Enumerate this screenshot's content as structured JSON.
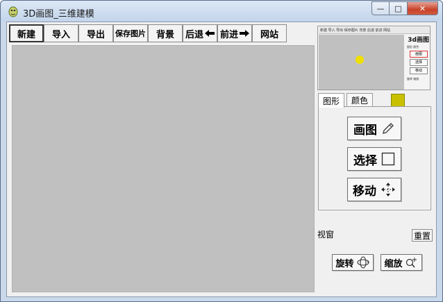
{
  "window": {
    "title": "3D画图_三维建模",
    "caption": {
      "minimize": "—",
      "maximize": "□",
      "close": "✕"
    }
  },
  "toolbar": {
    "new_label": "新建",
    "import_label": "导入",
    "export_label": "导出",
    "save_image_label": "保存图片",
    "background_label": "背景",
    "back_label": "后退",
    "forward_label": "前进",
    "website_label": "网站"
  },
  "preview": {
    "logo": "3d画图",
    "toolbar_text": "新建 导入 导出 保存图片 背景 后退 前进 网站",
    "tabs_text": "图形 颜色",
    "draw": "画图",
    "select": "选择",
    "move": "移动",
    "foot": "旋转 缩放",
    "dot_color": "#f0e000"
  },
  "tabs": [
    {
      "label": "图形",
      "active": true
    },
    {
      "label": "颜色",
      "active": false
    }
  ],
  "current_color": "#c8c000",
  "tools": {
    "draw_label": "画图",
    "select_label": "选择",
    "move_label": "移动"
  },
  "view": {
    "label": "视窗",
    "reset_label": "重置",
    "rotate_label": "旋转",
    "zoom_label": "缩放"
  },
  "canvas": {
    "background": "#c0c0c0"
  }
}
